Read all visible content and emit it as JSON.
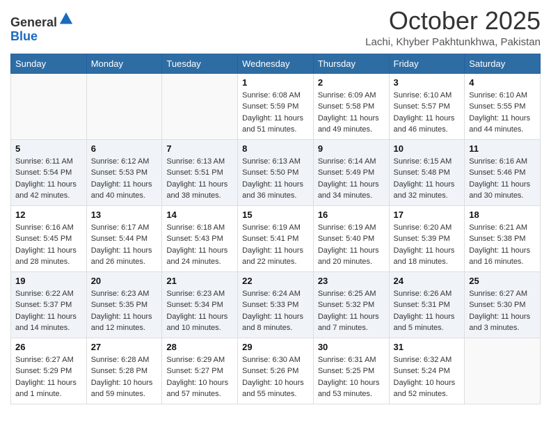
{
  "header": {
    "logo_general": "General",
    "logo_blue": "Blue",
    "month": "October 2025",
    "location": "Lachi, Khyber Pakhtunkhwa, Pakistan"
  },
  "days_of_week": [
    "Sunday",
    "Monday",
    "Tuesday",
    "Wednesday",
    "Thursday",
    "Friday",
    "Saturday"
  ],
  "weeks": [
    [
      {
        "day": "",
        "info": ""
      },
      {
        "day": "",
        "info": ""
      },
      {
        "day": "",
        "info": ""
      },
      {
        "day": "1",
        "info": "Sunrise: 6:08 AM\nSunset: 5:59 PM\nDaylight: 11 hours\nand 51 minutes."
      },
      {
        "day": "2",
        "info": "Sunrise: 6:09 AM\nSunset: 5:58 PM\nDaylight: 11 hours\nand 49 minutes."
      },
      {
        "day": "3",
        "info": "Sunrise: 6:10 AM\nSunset: 5:57 PM\nDaylight: 11 hours\nand 46 minutes."
      },
      {
        "day": "4",
        "info": "Sunrise: 6:10 AM\nSunset: 5:55 PM\nDaylight: 11 hours\nand 44 minutes."
      }
    ],
    [
      {
        "day": "5",
        "info": "Sunrise: 6:11 AM\nSunset: 5:54 PM\nDaylight: 11 hours\nand 42 minutes."
      },
      {
        "day": "6",
        "info": "Sunrise: 6:12 AM\nSunset: 5:53 PM\nDaylight: 11 hours\nand 40 minutes."
      },
      {
        "day": "7",
        "info": "Sunrise: 6:13 AM\nSunset: 5:51 PM\nDaylight: 11 hours\nand 38 minutes."
      },
      {
        "day": "8",
        "info": "Sunrise: 6:13 AM\nSunset: 5:50 PM\nDaylight: 11 hours\nand 36 minutes."
      },
      {
        "day": "9",
        "info": "Sunrise: 6:14 AM\nSunset: 5:49 PM\nDaylight: 11 hours\nand 34 minutes."
      },
      {
        "day": "10",
        "info": "Sunrise: 6:15 AM\nSunset: 5:48 PM\nDaylight: 11 hours\nand 32 minutes."
      },
      {
        "day": "11",
        "info": "Sunrise: 6:16 AM\nSunset: 5:46 PM\nDaylight: 11 hours\nand 30 minutes."
      }
    ],
    [
      {
        "day": "12",
        "info": "Sunrise: 6:16 AM\nSunset: 5:45 PM\nDaylight: 11 hours\nand 28 minutes."
      },
      {
        "day": "13",
        "info": "Sunrise: 6:17 AM\nSunset: 5:44 PM\nDaylight: 11 hours\nand 26 minutes."
      },
      {
        "day": "14",
        "info": "Sunrise: 6:18 AM\nSunset: 5:43 PM\nDaylight: 11 hours\nand 24 minutes."
      },
      {
        "day": "15",
        "info": "Sunrise: 6:19 AM\nSunset: 5:41 PM\nDaylight: 11 hours\nand 22 minutes."
      },
      {
        "day": "16",
        "info": "Sunrise: 6:19 AM\nSunset: 5:40 PM\nDaylight: 11 hours\nand 20 minutes."
      },
      {
        "day": "17",
        "info": "Sunrise: 6:20 AM\nSunset: 5:39 PM\nDaylight: 11 hours\nand 18 minutes."
      },
      {
        "day": "18",
        "info": "Sunrise: 6:21 AM\nSunset: 5:38 PM\nDaylight: 11 hours\nand 16 minutes."
      }
    ],
    [
      {
        "day": "19",
        "info": "Sunrise: 6:22 AM\nSunset: 5:37 PM\nDaylight: 11 hours\nand 14 minutes."
      },
      {
        "day": "20",
        "info": "Sunrise: 6:23 AM\nSunset: 5:35 PM\nDaylight: 11 hours\nand 12 minutes."
      },
      {
        "day": "21",
        "info": "Sunrise: 6:23 AM\nSunset: 5:34 PM\nDaylight: 11 hours\nand 10 minutes."
      },
      {
        "day": "22",
        "info": "Sunrise: 6:24 AM\nSunset: 5:33 PM\nDaylight: 11 hours\nand 8 minutes."
      },
      {
        "day": "23",
        "info": "Sunrise: 6:25 AM\nSunset: 5:32 PM\nDaylight: 11 hours\nand 7 minutes."
      },
      {
        "day": "24",
        "info": "Sunrise: 6:26 AM\nSunset: 5:31 PM\nDaylight: 11 hours\nand 5 minutes."
      },
      {
        "day": "25",
        "info": "Sunrise: 6:27 AM\nSunset: 5:30 PM\nDaylight: 11 hours\nand 3 minutes."
      }
    ],
    [
      {
        "day": "26",
        "info": "Sunrise: 6:27 AM\nSunset: 5:29 PM\nDaylight: 11 hours\nand 1 minute."
      },
      {
        "day": "27",
        "info": "Sunrise: 6:28 AM\nSunset: 5:28 PM\nDaylight: 10 hours\nand 59 minutes."
      },
      {
        "day": "28",
        "info": "Sunrise: 6:29 AM\nSunset: 5:27 PM\nDaylight: 10 hours\nand 57 minutes."
      },
      {
        "day": "29",
        "info": "Sunrise: 6:30 AM\nSunset: 5:26 PM\nDaylight: 10 hours\nand 55 minutes."
      },
      {
        "day": "30",
        "info": "Sunrise: 6:31 AM\nSunset: 5:25 PM\nDaylight: 10 hours\nand 53 minutes."
      },
      {
        "day": "31",
        "info": "Sunrise: 6:32 AM\nSunset: 5:24 PM\nDaylight: 10 hours\nand 52 minutes."
      },
      {
        "day": "",
        "info": ""
      }
    ]
  ]
}
